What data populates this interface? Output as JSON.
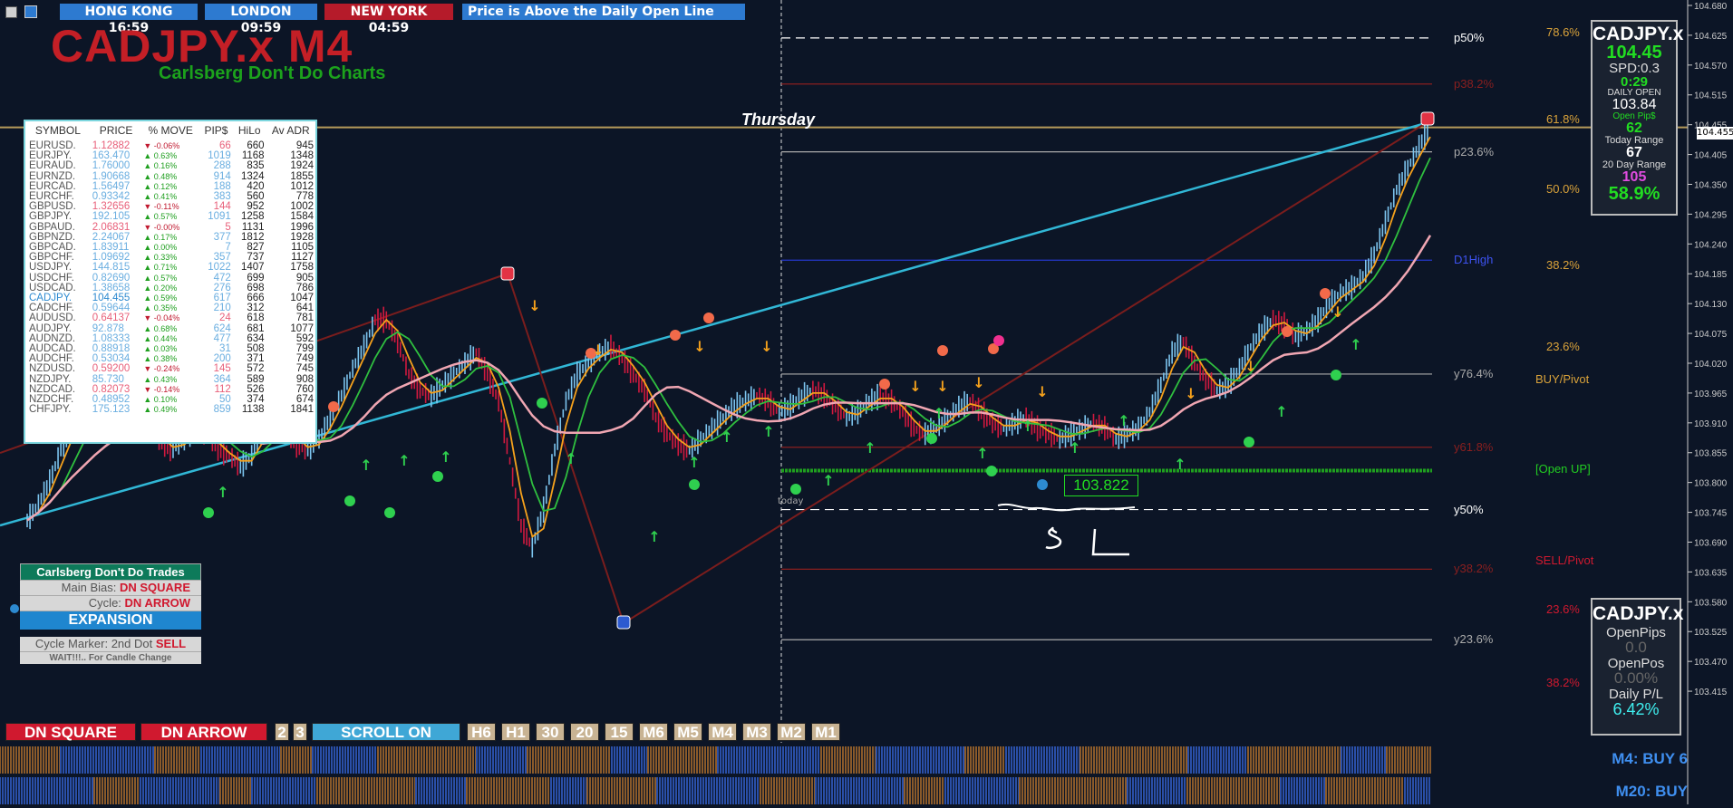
{
  "sessions": [
    {
      "label": "HONG KONG 16:59",
      "bg": "#2d7ad0"
    },
    {
      "label": "LONDON 09:59",
      "bg": "#2d7ad0"
    },
    {
      "label": "NEW YORK 04:59",
      "bg": "#b51b2a"
    },
    {
      "label": "Price is Above the Daily Open Line",
      "bg": "#2d7ad0"
    }
  ],
  "title": "CADJPY.x M4",
  "subtitle": "Carlsberg Don't Do Charts",
  "day_label": "Thursday",
  "today_label": "today",
  "open_price_label": "103.822",
  "handwritten": "SL",
  "symbol_table": {
    "headers": [
      "SYMBOL",
      "PRICE",
      "% MOVE",
      "PIP$",
      "HiLo",
      "Av ADR"
    ],
    "rows": [
      {
        "sym": "EURUSD.",
        "price": "1.12882",
        "dir": "down",
        "move": "-0.06%",
        "pips": "66",
        "hilo": "660",
        "adr": "945"
      },
      {
        "sym": "EURJPY.",
        "price": "163.470",
        "dir": "up",
        "move": "0.63%",
        "pips": "1019",
        "hilo": "1168",
        "adr": "1348"
      },
      {
        "sym": "EURAUD.",
        "price": "1.76000",
        "dir": "up",
        "move": "0.16%",
        "pips": "288",
        "hilo": "835",
        "adr": "1924"
      },
      {
        "sym": "EURNZD.",
        "price": "1.90668",
        "dir": "up",
        "move": "0.48%",
        "pips": "914",
        "hilo": "1324",
        "adr": "1855"
      },
      {
        "sym": "EURCAD.",
        "price": "1.56497",
        "dir": "up",
        "move": "0.12%",
        "pips": "188",
        "hilo": "420",
        "adr": "1012"
      },
      {
        "sym": "EURCHF.",
        "price": "0.93342",
        "dir": "up",
        "move": "0.41%",
        "pips": "383",
        "hilo": "560",
        "adr": "778"
      },
      {
        "sym": "GBPUSD.",
        "price": "1.32656",
        "dir": "down",
        "move": "-0.11%",
        "pips": "144",
        "hilo": "952",
        "adr": "1002"
      },
      {
        "sym": "GBPJPY.",
        "price": "192.105",
        "dir": "up",
        "move": "0.57%",
        "pips": "1091",
        "hilo": "1258",
        "adr": "1584"
      },
      {
        "sym": "GBPAUD.",
        "price": "2.06831",
        "dir": "down",
        "move": "-0.00%",
        "pips": "5",
        "hilo": "1131",
        "adr": "1996"
      },
      {
        "sym": "GBPNZD.",
        "price": "2.24067",
        "dir": "up",
        "move": "0.17%",
        "pips": "377",
        "hilo": "1812",
        "adr": "1928"
      },
      {
        "sym": "GBPCAD.",
        "price": "1.83911",
        "dir": "up",
        "move": "0.00%",
        "pips": "7",
        "hilo": "827",
        "adr": "1105"
      },
      {
        "sym": "GBPCHF.",
        "price": "1.09692",
        "dir": "up",
        "move": "0.33%",
        "pips": "357",
        "hilo": "737",
        "adr": "1127"
      },
      {
        "sym": "USDJPY.",
        "price": "144.815",
        "dir": "up",
        "move": "0.71%",
        "pips": "1022",
        "hilo": "1407",
        "adr": "1758"
      },
      {
        "sym": "USDCHF.",
        "price": "0.82690",
        "dir": "up",
        "move": "0.57%",
        "pips": "472",
        "hilo": "699",
        "adr": "905"
      },
      {
        "sym": "USDCAD.",
        "price": "1.38658",
        "dir": "up",
        "move": "0.20%",
        "pips": "276",
        "hilo": "698",
        "adr": "786"
      },
      {
        "sym": "CADJPY.",
        "price": "104.455",
        "dir": "up",
        "move": "0.59%",
        "pips": "617",
        "hilo": "666",
        "adr": "1047",
        "highlight": true
      },
      {
        "sym": "CADCHF.",
        "price": "0.59644",
        "dir": "up",
        "move": "0.35%",
        "pips": "210",
        "hilo": "312",
        "adr": "641"
      },
      {
        "sym": "AUDUSD.",
        "price": "0.64137",
        "dir": "down",
        "move": "-0.04%",
        "pips": "24",
        "hilo": "618",
        "adr": "781"
      },
      {
        "sym": "AUDJPY.",
        "price": "92.878",
        "dir": "up",
        "move": "0.68%",
        "pips": "624",
        "hilo": "681",
        "adr": "1077"
      },
      {
        "sym": "AUDNZD.",
        "price": "1.08333",
        "dir": "up",
        "move": "0.44%",
        "pips": "477",
        "hilo": "634",
        "adr": "592"
      },
      {
        "sym": "AUDCAD.",
        "price": "0.88918",
        "dir": "up",
        "move": "0.03%",
        "pips": "31",
        "hilo": "508",
        "adr": "799"
      },
      {
        "sym": "AUDCHF.",
        "price": "0.53034",
        "dir": "up",
        "move": "0.38%",
        "pips": "200",
        "hilo": "371",
        "adr": "749"
      },
      {
        "sym": "NZDUSD.",
        "price": "0.59200",
        "dir": "down",
        "move": "-0.24%",
        "pips": "145",
        "hilo": "572",
        "adr": "745"
      },
      {
        "sym": "NZDJPY.",
        "price": "85.730",
        "dir": "up",
        "move": "0.43%",
        "pips": "364",
        "hilo": "589",
        "adr": "908"
      },
      {
        "sym": "NZDCAD.",
        "price": "0.82073",
        "dir": "down",
        "move": "-0.14%",
        "pips": "112",
        "hilo": "526",
        "adr": "760"
      },
      {
        "sym": "NZDCHF.",
        "price": "0.48952",
        "dir": "up",
        "move": "0.10%",
        "pips": "50",
        "hilo": "374",
        "adr": "674"
      },
      {
        "sym": "CHFJPY.",
        "price": "175.123",
        "dir": "up",
        "move": "0.49%",
        "pips": "859",
        "hilo": "1138",
        "adr": "1841"
      }
    ]
  },
  "info_box_top": {
    "symbol": "CADJPY.x",
    "price": "104.45",
    "spread": "SPD:0.3",
    "timer": "0:29",
    "daily_open_label": "DAILY OPEN",
    "daily_open": "103.84",
    "open_pips_label": "Open Pip$",
    "open_pips": "62",
    "today_range_label": "Today Range",
    "today_range": "67",
    "day20_label": "20 Day Range",
    "day20": "105",
    "pct": "58.9%"
  },
  "info_box_bottom": {
    "symbol": "CADJPY.x",
    "open_pips_label": "OpenPips",
    "open_pips": "0.0",
    "open_pos_label": "OpenPos",
    "open_pos": "0.00%",
    "daily_pl_label": "Daily P/L",
    "daily_pl": "6.42%"
  },
  "left_panel": {
    "header": "Carlsberg Don't Do Trades",
    "bias_label": "Main Bias:",
    "bias_value": "DN SQUARE",
    "cycle_label": "Cycle:",
    "cycle_value": "DN ARROW",
    "expansion": "EXPANSION",
    "marker_label": "Cycle Marker: 2nd Dot",
    "marker_value": "SELL",
    "wait": "WAIT!!!.. For Candle Change"
  },
  "bottom_buttons": [
    {
      "label": "DN SQUARE",
      "style": "red"
    },
    {
      "label": "DN ARROW",
      "style": "red"
    },
    {
      "label": "2",
      "style": "tan"
    },
    {
      "label": "3",
      "style": "tan"
    },
    {
      "label": "SCROLL ON",
      "style": "blue"
    },
    {
      "label": "H6",
      "style": "tan"
    },
    {
      "label": "H1",
      "style": "tan"
    },
    {
      "label": "30",
      "style": "tan"
    },
    {
      "label": "20",
      "style": "tan"
    },
    {
      "label": "15",
      "style": "tan"
    },
    {
      "label": "M6",
      "style": "tan"
    },
    {
      "label": "M5",
      "style": "tan"
    },
    {
      "label": "M4",
      "style": "tan"
    },
    {
      "label": "M3",
      "style": "tan"
    },
    {
      "label": "M2",
      "style": "tan"
    },
    {
      "label": "M1",
      "style": "tan"
    }
  ],
  "strip_labels": [
    "M4: BUY 6",
    "M20: BUY"
  ],
  "fib_left": [
    {
      "label": "p50%",
      "price": 104.62,
      "color": "#ffffff"
    },
    {
      "label": "p38.2%",
      "price": 104.535,
      "color": "#8a1f1f"
    },
    {
      "label": "p23.6%",
      "price": 104.41,
      "color": "#aaaaaa"
    },
    {
      "label": "D1High",
      "price": 104.21,
      "color": "#2436c8"
    },
    {
      "label": "y76.4%",
      "price": 104.0,
      "color": "#aaaaaa"
    },
    {
      "label": "y61.8%",
      "price": 103.865,
      "color": "#8a1f1f"
    },
    {
      "label": "y50%",
      "price": 103.75,
      "color": "#ffffff"
    },
    {
      "label": "y38.2%",
      "price": 103.64,
      "color": "#8a1f1f"
    },
    {
      "label": "y23.6%",
      "price": 103.51,
      "color": "#aaaaaa"
    }
  ],
  "fib_right": [
    {
      "label": "78.6%",
      "y_price": 104.63,
      "color": "#d9a23a"
    },
    {
      "label": "61.8%",
      "y_price": 104.47,
      "color": "#d9a23a"
    },
    {
      "label": "50.0%",
      "y_price": 104.34,
      "color": "#d9a23a"
    },
    {
      "label": "38.2%",
      "y_price": 104.2,
      "color": "#d9a23a"
    },
    {
      "label": "23.6%",
      "y_price": 104.05,
      "color": "#d9a23a"
    },
    {
      "label": "BUY/Pivot",
      "y_price": 103.99,
      "color": "#d9a23a"
    },
    {
      "label": "[Open UP]",
      "y_price": 103.825,
      "color": "#22cc22"
    },
    {
      "label": "SELL/Pivot",
      "y_price": 103.655,
      "color": "#d0192f"
    },
    {
      "label": "23.6%",
      "y_price": 103.565,
      "color": "#d0192f"
    },
    {
      "label": "38.2%",
      "y_price": 103.43,
      "color": "#d0192f"
    }
  ],
  "chart_data": {
    "type": "line",
    "symbol": "CADJPY.x",
    "timeframe": "M4",
    "ylim": [
      103.37,
      104.68
    ],
    "y_ticks": [
      104.68,
      104.625,
      104.57,
      104.515,
      104.46,
      104.405,
      104.35,
      104.295,
      104.24,
      104.185,
      104.13,
      104.075,
      104.02,
      103.965,
      103.91,
      103.855,
      103.8,
      103.745,
      103.69,
      103.635,
      103.58,
      103.525,
      103.47,
      103.415
    ],
    "y_tick_labels": [
      "104.680",
      "104.625",
      "104.570",
      "104.515",
      "104.455",
      "104.405",
      "104.350",
      "104.295",
      "104.240",
      "104.185",
      "104.130",
      "104.075",
      "104.020",
      "103.965",
      "103.910",
      "103.855",
      "103.800",
      "103.745",
      "103.690",
      "103.635",
      "103.580",
      "103.525",
      "103.470",
      "103.415"
    ],
    "current_price": 104.455,
    "daily_open": 103.822,
    "close_series": [
      103.73,
      103.76,
      103.8,
      103.86,
      103.9,
      103.93,
      103.97,
      103.99,
      104.0,
      103.98,
      103.95,
      103.9,
      103.87,
      103.86,
      103.88,
      103.9,
      103.89,
      103.86,
      103.85,
      103.83,
      103.85,
      103.9,
      103.93,
      103.9,
      103.87,
      103.86,
      103.88,
      103.92,
      103.96,
      104.01,
      104.05,
      104.1,
      104.1,
      104.06,
      104.0,
      103.97,
      103.96,
      103.98,
      104.0,
      104.02,
      104.04,
      104.0,
      103.95,
      103.84,
      103.72,
      103.68,
      103.75,
      103.86,
      103.95,
      104.0,
      104.02,
      104.04,
      104.05,
      104.03,
      104.0,
      103.97,
      103.92,
      103.89,
      103.87,
      103.86,
      103.88,
      103.9,
      103.92,
      103.94,
      103.95,
      103.96,
      103.95,
      103.93,
      103.94,
      103.96,
      103.97,
      103.96,
      103.94,
      103.92,
      103.93,
      103.95,
      103.96,
      103.95,
      103.93,
      103.9,
      103.89,
      103.9,
      103.92,
      103.94,
      103.95,
      103.93,
      103.91,
      103.9,
      103.91,
      103.92,
      103.9,
      103.89,
      103.88,
      103.89,
      103.9,
      103.91,
      103.9,
      103.88,
      103.89,
      103.9,
      103.93,
      103.98,
      104.04,
      104.06,
      104.02,
      103.99,
      103.97,
      103.98,
      104.01,
      104.05,
      104.08,
      104.1,
      104.09,
      104.07,
      104.08,
      104.1,
      104.13,
      104.15,
      104.16,
      104.18,
      104.22,
      104.28,
      104.34,
      104.38,
      104.42,
      104.455
    ],
    "series": [
      {
        "name": "orange",
        "color": "#f5a11c"
      },
      {
        "name": "green",
        "color": "#2fbf3f"
      },
      {
        "name": "pink",
        "color": "#f0a6b2"
      }
    ]
  }
}
